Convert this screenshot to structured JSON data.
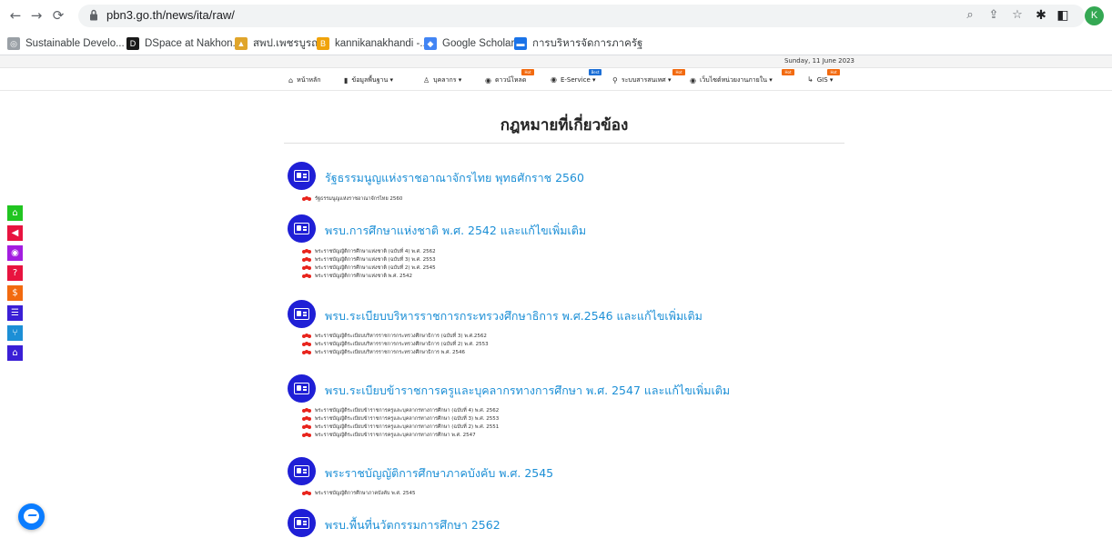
{
  "browser": {
    "url": "pbn3.go.th/news/ita/raw/",
    "profile_initial": "K",
    "bookmarks": [
      {
        "label": "Sustainable Develo...",
        "icon": "un-globe-icon",
        "color": "#9aa0a6"
      },
      {
        "label": "DSpace at Nakhon...",
        "icon": "dspace-icon",
        "color": "#1a1a1a"
      },
      {
        "label": "สพป.เพชรบูรณ์",
        "icon": "temple-icon",
        "color": "#e0a52b"
      },
      {
        "label": "kannikanakhandi -...",
        "icon": "blogger-icon",
        "color": "#f0a30a"
      },
      {
        "label": "Google Scholar",
        "icon": "scholar-icon",
        "color": "#4285f4"
      },
      {
        "label": "การบริหารจัดการภาครัฐ",
        "icon": "gov-icon",
        "color": "#1a73e8"
      }
    ]
  },
  "site": {
    "date": "Sunday, 11 June 2023",
    "nav": [
      {
        "label": "หน้าหลัก",
        "icon": "home-icon",
        "badge": ""
      },
      {
        "label": "ข้อมูลพื้นฐาน ▾",
        "icon": "book-icon",
        "badge": ""
      },
      {
        "label": "บุคลากร ▾",
        "icon": "person-icon",
        "badge": ""
      },
      {
        "label": "ดาวน์โหลด",
        "icon": "download-icon",
        "badge": "Hot"
      },
      {
        "label": "E-Service ▾",
        "icon": "eservice-icon",
        "badge": "Best"
      },
      {
        "label": "ระบบสารสนเทศ ▾",
        "icon": "network-icon",
        "badge": "Hot"
      },
      {
        "label": "เว็บไซต์หน่วยงานภายใน ▾",
        "icon": "globe-icon",
        "badge": "Hot"
      },
      {
        "label": "GIS ▾",
        "icon": "map-pin-icon",
        "badge": "Hot"
      }
    ]
  },
  "page": {
    "title": "กฎหมายที่เกี่ยวข้อง",
    "sections": [
      {
        "title": "รัฐธรรมนูญแห่งราชอาณาจักรไทย พุทธศักราช 2560",
        "docs": [
          "รัฐธรรมนูญแห่งราชอาณาจักรไทย 2560"
        ]
      },
      {
        "title": "พรบ.การศึกษาแห่งชาติ พ.ศ. 2542 และแก้ไขเพิ่มเติม",
        "docs": [
          "พระราชบัญญัติการศึกษาแห่งชาติ (ฉบับที่ 4) พ.ศ. 2562",
          "พระราชบัญญัติการศึกษาแห่งชาติ (ฉบับที่ 3) พ.ศ. 2553",
          "พระราชบัญญัติการศึกษาแห่งชาติ (ฉบับที่ 2) พ.ศ. 2545",
          "พระราชบัญญัติการศึกษาแห่งชาติ พ.ศ. 2542"
        ]
      },
      {
        "title": "พรบ.ระเบียบบริหารราชการกระทรวงศึกษาธิการ พ.ศ.2546 และแก้ไขเพิ่มเติม",
        "docs": [
          "พระราชบัญญัติระเบียบบริหารราชการกระทรวงศึกษาธิการ (ฉบับที่ 3) พ.ศ.2562",
          "พระราชบัญญัติระเบียบบริหารราชการกระทรวงศึกษาธิการ (ฉบับที่ 2) พ.ศ. 2553",
          "พระราชบัญญัติระเบียบบริหารราชการกระทรวงศึกษาธิการ พ.ศ. 2546"
        ]
      },
      {
        "title": "พรบ.ระเบียบข้าราชการครูและบุคลากรทางการศึกษา พ.ศ. 2547 และแก้ไขเพิ่มเติม",
        "docs": [
          "พระราชบัญญัติระเบียบข้าราชการครูและบุคลากรทางการศึกษา (ฉบับที่ 4) พ.ศ. 2562",
          "พระราชบัญญัติระเบียบข้าราชการครูและบุคลากรทางการศึกษา (ฉบับที่ 3) พ.ศ. 2553",
          "พระราชบัญญัติระเบียบข้าราชการครูและบุคลากรทางการศึกษา (ฉบับที่ 2) พ.ศ. 2551",
          "พระราชบัญญัติระเบียบข้าราชการครูและบุคลากรทางการศึกษา พ.ศ. 2547"
        ]
      },
      {
        "title": "พระราชบัญญัติการศึกษาภาคบังคับ พ.ศ. 2545",
        "docs": [
          "พระราชบัญญัติการศึกษาภาคบังคับ พ.ศ. 2545"
        ]
      },
      {
        "title": "พรบ.พื้นที่นวัตกรรมการศึกษา 2562",
        "docs": []
      }
    ]
  },
  "float_bar": [
    {
      "icon": "home-icon",
      "color": "#21c521"
    },
    {
      "icon": "megaphone-icon",
      "color": "#e8133f"
    },
    {
      "icon": "eye-icon",
      "color": "#a31de0"
    },
    {
      "icon": "question-icon",
      "color": "#e8133f"
    },
    {
      "icon": "dollar-icon",
      "color": "#f26a0f"
    },
    {
      "icon": "list-icon",
      "color": "#3a1fd6"
    },
    {
      "icon": "flow-icon",
      "color": "#1c8fd6"
    },
    {
      "icon": "building-icon",
      "color": "#3a1fd6"
    }
  ],
  "colors": {
    "accent": "#1c8fd6",
    "icon_circle": "#1f1fd6",
    "doc_icon": "#e8231c"
  }
}
